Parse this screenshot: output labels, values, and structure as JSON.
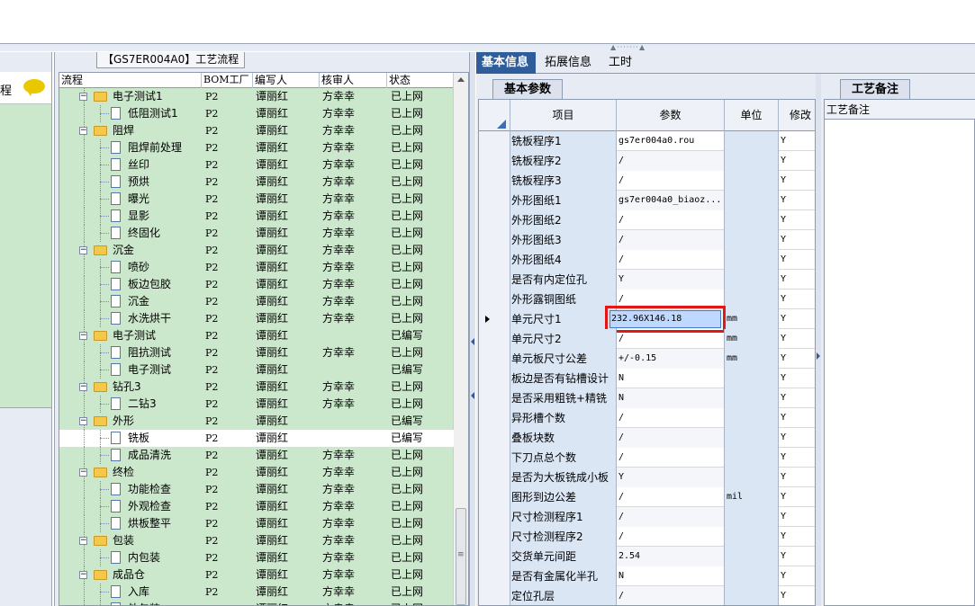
{
  "left_panel": {
    "text": "程"
  },
  "middle": {
    "title": "【GS7ER004A0】工艺流程",
    "columns": [
      "流程",
      "BOM工厂",
      "编写人",
      "核审人",
      "状态"
    ],
    "rows": [
      {
        "level": 1,
        "type": "folder",
        "name": "电子测试1",
        "bom": "P2",
        "writer": "谭丽红",
        "reviewer": "方幸幸",
        "status": "已上网"
      },
      {
        "level": 2,
        "type": "doc",
        "name": "低阻测试1",
        "bom": "P2",
        "writer": "谭丽红",
        "reviewer": "方幸幸",
        "status": "已上网"
      },
      {
        "level": 1,
        "type": "folder",
        "name": "阻焊",
        "bom": "P2",
        "writer": "谭丽红",
        "reviewer": "方幸幸",
        "status": "已上网"
      },
      {
        "level": 2,
        "type": "doc",
        "name": "阻焊前处理",
        "bom": "P2",
        "writer": "谭丽红",
        "reviewer": "方幸幸",
        "status": "已上网"
      },
      {
        "level": 2,
        "type": "doc",
        "name": "丝印",
        "bom": "P2",
        "writer": "谭丽红",
        "reviewer": "方幸幸",
        "status": "已上网"
      },
      {
        "level": 2,
        "type": "doc",
        "name": "预烘",
        "bom": "P2",
        "writer": "谭丽红",
        "reviewer": "方幸幸",
        "status": "已上网"
      },
      {
        "level": 2,
        "type": "doc",
        "name": "曝光",
        "bom": "P2",
        "writer": "谭丽红",
        "reviewer": "方幸幸",
        "status": "已上网"
      },
      {
        "level": 2,
        "type": "doc",
        "name": "显影",
        "bom": "P2",
        "writer": "谭丽红",
        "reviewer": "方幸幸",
        "status": "已上网"
      },
      {
        "level": 2,
        "type": "doc",
        "name": "终固化",
        "bom": "P2",
        "writer": "谭丽红",
        "reviewer": "方幸幸",
        "status": "已上网"
      },
      {
        "level": 1,
        "type": "folder",
        "name": "沉金",
        "bom": "P2",
        "writer": "谭丽红",
        "reviewer": "方幸幸",
        "status": "已上网"
      },
      {
        "level": 2,
        "type": "doc",
        "name": "喷砂",
        "bom": "P2",
        "writer": "谭丽红",
        "reviewer": "方幸幸",
        "status": "已上网"
      },
      {
        "level": 2,
        "type": "doc",
        "name": "板边包胶",
        "bom": "P2",
        "writer": "谭丽红",
        "reviewer": "方幸幸",
        "status": "已上网"
      },
      {
        "level": 2,
        "type": "doc",
        "name": "沉金",
        "bom": "P2",
        "writer": "谭丽红",
        "reviewer": "方幸幸",
        "status": "已上网"
      },
      {
        "level": 2,
        "type": "doc",
        "name": "水洗烘干",
        "bom": "P2",
        "writer": "谭丽红",
        "reviewer": "方幸幸",
        "status": "已上网"
      },
      {
        "level": 1,
        "type": "folder",
        "name": "电子测试",
        "bom": "P2",
        "writer": "谭丽红",
        "reviewer": "",
        "status": "已编写"
      },
      {
        "level": 2,
        "type": "doc",
        "name": "阻抗测试",
        "bom": "P2",
        "writer": "谭丽红",
        "reviewer": "方幸幸",
        "status": "已上网"
      },
      {
        "level": 2,
        "type": "doc",
        "name": "电子测试",
        "bom": "P2",
        "writer": "谭丽红",
        "reviewer": "",
        "status": "已编写"
      },
      {
        "level": 1,
        "type": "folder",
        "name": "钻孔3",
        "bom": "P2",
        "writer": "谭丽红",
        "reviewer": "方幸幸",
        "status": "已上网"
      },
      {
        "level": 2,
        "type": "doc",
        "name": "二钻3",
        "bom": "P2",
        "writer": "谭丽红",
        "reviewer": "方幸幸",
        "status": "已上网"
      },
      {
        "level": 1,
        "type": "folder",
        "name": "外形",
        "bom": "P2",
        "writer": "谭丽红",
        "reviewer": "",
        "status": "已编写"
      },
      {
        "level": 2,
        "type": "doc",
        "name": "铣板",
        "bom": "P2",
        "writer": "谭丽红",
        "reviewer": "",
        "status": "已编写",
        "selected": true
      },
      {
        "level": 2,
        "type": "doc",
        "name": "成品清洗",
        "bom": "P2",
        "writer": "谭丽红",
        "reviewer": "方幸幸",
        "status": "已上网"
      },
      {
        "level": 1,
        "type": "folder",
        "name": "终检",
        "bom": "P2",
        "writer": "谭丽红",
        "reviewer": "方幸幸",
        "status": "已上网"
      },
      {
        "level": 2,
        "type": "doc",
        "name": "功能检查",
        "bom": "P2",
        "writer": "谭丽红",
        "reviewer": "方幸幸",
        "status": "已上网"
      },
      {
        "level": 2,
        "type": "doc",
        "name": "外观检查",
        "bom": "P2",
        "writer": "谭丽红",
        "reviewer": "方幸幸",
        "status": "已上网"
      },
      {
        "level": 2,
        "type": "doc",
        "name": "烘板整平",
        "bom": "P2",
        "writer": "谭丽红",
        "reviewer": "方幸幸",
        "status": "已上网"
      },
      {
        "level": 1,
        "type": "folder",
        "name": "包装",
        "bom": "P2",
        "writer": "谭丽红",
        "reviewer": "方幸幸",
        "status": "已上网"
      },
      {
        "level": 2,
        "type": "doc",
        "name": "内包装",
        "bom": "P2",
        "writer": "谭丽红",
        "reviewer": "方幸幸",
        "status": "已上网"
      },
      {
        "level": 1,
        "type": "folder",
        "name": "成品仓",
        "bom": "P2",
        "writer": "谭丽红",
        "reviewer": "方幸幸",
        "status": "已上网"
      },
      {
        "level": 2,
        "type": "doc",
        "name": "入库",
        "bom": "P2",
        "writer": "谭丽红",
        "reviewer": "方幸幸",
        "status": "已上网"
      },
      {
        "level": 2,
        "type": "doc",
        "name": "外包装",
        "bom": "P2",
        "writer": "谭丽红",
        "reviewer": "方幸幸",
        "status": "已上网"
      }
    ]
  },
  "right": {
    "tabs": [
      "基本信息",
      "拓展信息",
      "工时"
    ],
    "subtab": "基本参数",
    "note_subtab": "工艺备注",
    "note_header": "工艺备注",
    "columns": [
      "项目",
      "参数",
      "单位",
      "修改"
    ],
    "rows": [
      {
        "item": "铣板程序1",
        "param": "gs7er004a0.rou",
        "unit": "",
        "mod": "Y"
      },
      {
        "item": "铣板程序2",
        "param": "/",
        "unit": "",
        "mod": "Y"
      },
      {
        "item": "铣板程序3",
        "param": "/",
        "unit": "",
        "mod": "Y"
      },
      {
        "item": "外形图纸1",
        "param": "gs7er004a0_biaoz...",
        "unit": "",
        "mod": "Y"
      },
      {
        "item": "外形图纸2",
        "param": "/",
        "unit": "",
        "mod": "Y"
      },
      {
        "item": "外形图纸3",
        "param": "/",
        "unit": "",
        "mod": "Y"
      },
      {
        "item": "外形图纸4",
        "param": "/",
        "unit": "",
        "mod": "Y"
      },
      {
        "item": "是否有内定位孔",
        "param": "Y",
        "unit": "",
        "mod": "Y"
      },
      {
        "item": "外形露铜图纸",
        "param": "/",
        "unit": "",
        "mod": "Y"
      },
      {
        "item": "单元尺寸1",
        "param": "232.96X146.18",
        "unit": "mm",
        "mod": "Y",
        "current": true
      },
      {
        "item": "单元尺寸2",
        "param": "/",
        "unit": "mm",
        "mod": "Y"
      },
      {
        "item": "单元板尺寸公差",
        "param": "+/-0.15",
        "unit": "mm",
        "mod": "Y"
      },
      {
        "item": "板边是否有钻槽设计",
        "param": "N",
        "unit": "",
        "mod": "Y"
      },
      {
        "item": "是否采用粗铣+精铣",
        "param": "N",
        "unit": "",
        "mod": "Y"
      },
      {
        "item": "异形槽个数",
        "param": "/",
        "unit": "",
        "mod": "Y"
      },
      {
        "item": "叠板块数",
        "param": "/",
        "unit": "",
        "mod": "Y"
      },
      {
        "item": "下刀点总个数",
        "param": "/",
        "unit": "",
        "mod": "Y"
      },
      {
        "item": "是否为大板铣成小板",
        "param": "Y",
        "unit": "",
        "mod": "Y"
      },
      {
        "item": "图形到边公差",
        "param": "/",
        "unit": "mil",
        "mod": "Y"
      },
      {
        "item": "尺寸检测程序1",
        "param": "/",
        "unit": "",
        "mod": "Y"
      },
      {
        "item": "尺寸检测程序2",
        "param": "/",
        "unit": "",
        "mod": "Y"
      },
      {
        "item": "交货单元间距",
        "param": "2.54",
        "unit": "",
        "mod": "Y"
      },
      {
        "item": "是否有金属化半孔",
        "param": "N",
        "unit": "",
        "mod": "Y"
      },
      {
        "item": "定位孔层",
        "param": "/",
        "unit": "",
        "mod": "Y"
      }
    ]
  }
}
